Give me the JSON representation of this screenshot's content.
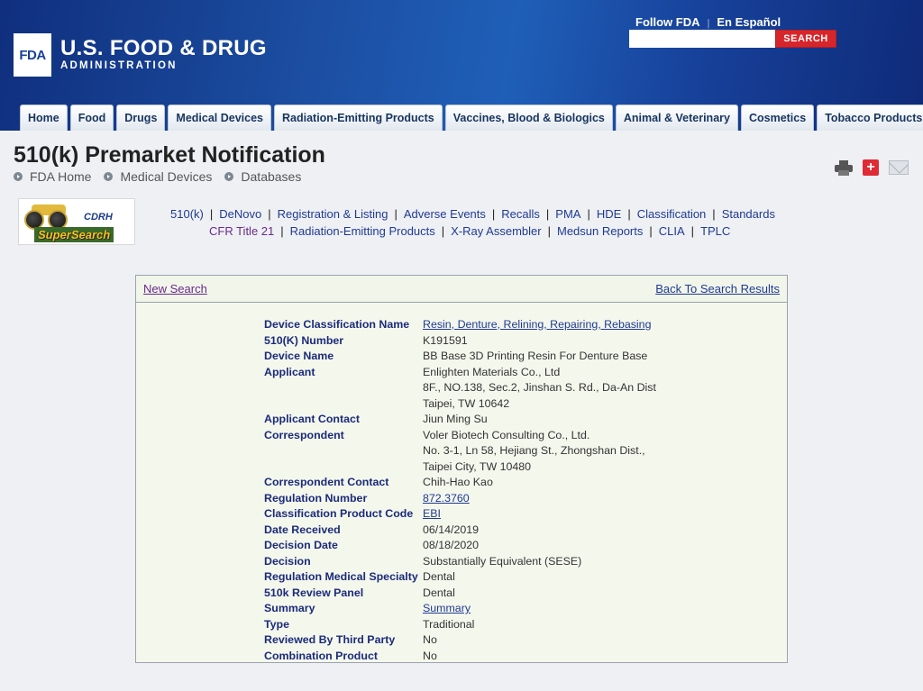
{
  "header": {
    "logo_badge": "FDA",
    "logo_title": "U.S. FOOD & DRUG",
    "logo_subtitle": "ADMINISTRATION",
    "follow_link": "Follow FDA",
    "spanish_link": "En Español",
    "top_separator": "|",
    "search_placeholder": "",
    "search_button": "SEARCH"
  },
  "nav": {
    "tabs": [
      "Home",
      "Food",
      "Drugs",
      "Medical Devices",
      "Radiation-Emitting Products",
      "Vaccines, Blood & Biologics",
      "Animal & Veterinary",
      "Cosmetics",
      "Tobacco Products"
    ]
  },
  "page": {
    "title": "510(k) Premarket Notification",
    "breadcrumb": [
      "FDA Home",
      "Medical Devices",
      "Databases"
    ]
  },
  "supersearch": {
    "line1": "CDRH",
    "line2": "SuperSearch"
  },
  "db_links": {
    "row1": [
      "510(k)",
      "DeNovo",
      "Registration & Listing",
      "Adverse Events",
      "Recalls",
      "PMA",
      "HDE",
      "Classification",
      "Standards"
    ],
    "row2": [
      "CFR Title 21",
      "Radiation-Emitting Products",
      "X-Ray Assembler",
      "Medsun Reports",
      "CLIA",
      "TPLC"
    ],
    "separator": "|"
  },
  "panel": {
    "new_search": "New Search",
    "back_to_results": "Back To Search Results",
    "fields": [
      {
        "label": "Device Classification Name",
        "value": "Resin, Denture, Relining, Repairing, Rebasing",
        "link": true
      },
      {
        "label": "510(K) Number",
        "value": "K191591"
      },
      {
        "label": "Device Name",
        "value": "BB Base 3D Printing Resin For Denture Base"
      },
      {
        "label": "Applicant",
        "value": "Enlighten Materials Co., Ltd",
        "extra": [
          "8F., NO.138, Sec.2, Jinshan S. Rd., Da-An Dist",
          "Taipei,  TW 10642"
        ]
      },
      {
        "label": "Applicant Contact",
        "value": "Jiun Ming Su"
      },
      {
        "label": "Correspondent",
        "value": "Voler Biotech Consulting Co., Ltd.",
        "extra": [
          "No. 3-1, Ln 58, Hejiang St., Zhongshan Dist.,",
          "Taipei City,  TW 10480"
        ]
      },
      {
        "label": "Correspondent Contact",
        "value": "Chih-Hao Kao"
      },
      {
        "label": "Regulation Number",
        "value": "872.3760",
        "link": true
      },
      {
        "label": "Classification Product Code",
        "value": "EBI",
        "link": true
      },
      {
        "label": "Date Received",
        "value": "06/14/2019"
      },
      {
        "label": "Decision Date",
        "value": "08/18/2020"
      },
      {
        "label": "Decision",
        "value": "Substantially Equivalent (SESE)"
      },
      {
        "label": "Regulation Medical Specialty",
        "value": "Dental"
      },
      {
        "label": "510k Review Panel",
        "value": "Dental"
      },
      {
        "label": "Summary",
        "value": "Summary",
        "link": true
      },
      {
        "label": "Type",
        "value": "Traditional"
      },
      {
        "label": "Reviewed By Third Party",
        "value": "No"
      },
      {
        "label": "Combination Product",
        "value": "No"
      }
    ]
  }
}
